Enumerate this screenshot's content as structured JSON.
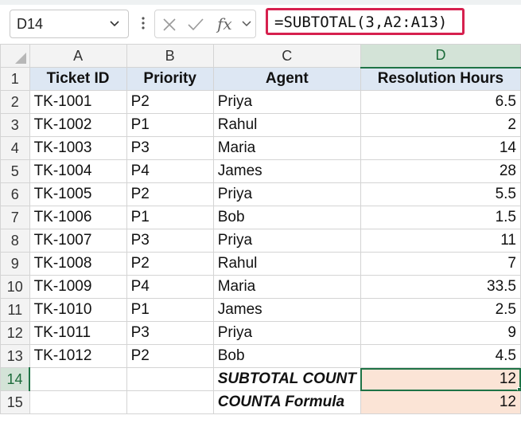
{
  "formula_bar": {
    "name_box": "D14",
    "fx_label": "fx",
    "formula": "=SUBTOTAL(3,A2:A13)"
  },
  "columns": [
    "A",
    "B",
    "C",
    "D"
  ],
  "header_row": {
    "row_num": "1",
    "cells": [
      "Ticket ID",
      "Priority",
      "Agent",
      "Resolution Hours"
    ]
  },
  "rows": [
    {
      "row_num": "2",
      "ticket": "TK-1001",
      "priority": "P2",
      "agent": "Priya",
      "hours": "6.5"
    },
    {
      "row_num": "3",
      "ticket": "TK-1002",
      "priority": "P1",
      "agent": "Rahul",
      "hours": "2"
    },
    {
      "row_num": "4",
      "ticket": "TK-1003",
      "priority": "P3",
      "agent": "Maria",
      "hours": "14"
    },
    {
      "row_num": "5",
      "ticket": "TK-1004",
      "priority": "P4",
      "agent": "James",
      "hours": "28"
    },
    {
      "row_num": "6",
      "ticket": "TK-1005",
      "priority": "P2",
      "agent": "Priya",
      "hours": "5.5"
    },
    {
      "row_num": "7",
      "ticket": "TK-1006",
      "priority": "P1",
      "agent": "Bob",
      "hours": "1.5"
    },
    {
      "row_num": "8",
      "ticket": "TK-1007",
      "priority": "P3",
      "agent": "Priya",
      "hours": "11"
    },
    {
      "row_num": "9",
      "ticket": "TK-1008",
      "priority": "P2",
      "agent": "Rahul",
      "hours": "7"
    },
    {
      "row_num": "10",
      "ticket": "TK-1009",
      "priority": "P4",
      "agent": "Maria",
      "hours": "33.5"
    },
    {
      "row_num": "11",
      "ticket": "TK-1010",
      "priority": "P1",
      "agent": "James",
      "hours": "2.5"
    },
    {
      "row_num": "12",
      "ticket": "TK-1011",
      "priority": "P3",
      "agent": "Priya",
      "hours": "9"
    },
    {
      "row_num": "13",
      "ticket": "TK-1012",
      "priority": "P2",
      "agent": "Bob",
      "hours": "4.5"
    }
  ],
  "summary": [
    {
      "row_num": "14",
      "label": "SUBTOTAL COUNT",
      "value": "12"
    },
    {
      "row_num": "15",
      "label": "COUNTA Formula",
      "value": "12"
    }
  ],
  "colors": {
    "formula_highlight": "#d6204e",
    "header_fill": "#dde7f3",
    "result_fill": "#fbe4d6",
    "selection": "#1f7346"
  }
}
